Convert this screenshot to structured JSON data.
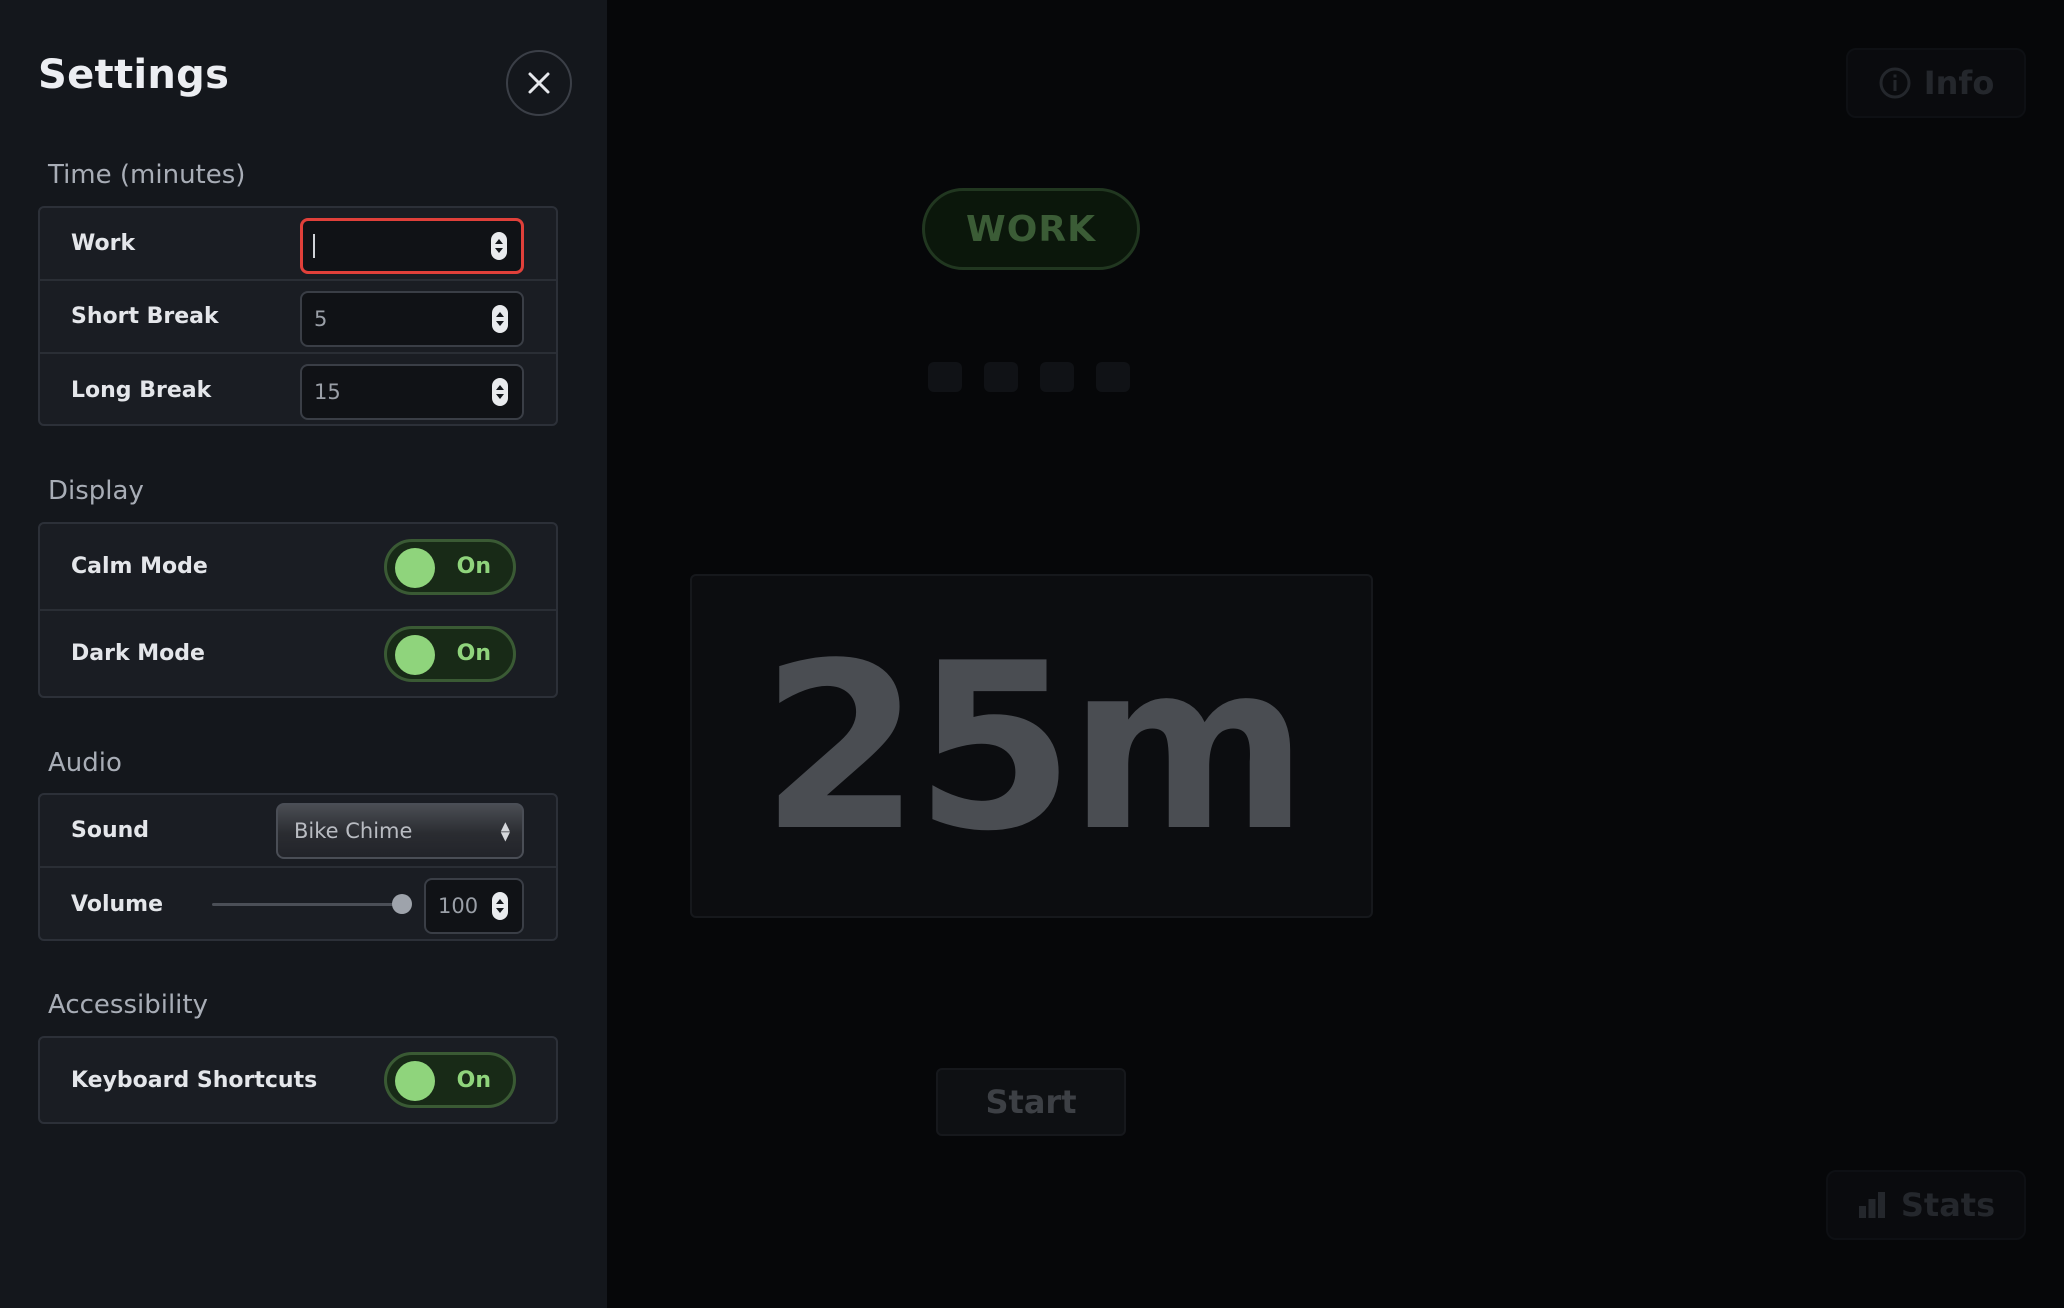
{
  "settings": {
    "title": "Settings",
    "sections": {
      "time": {
        "label": "Time (minutes)",
        "work": {
          "label": "Work",
          "value": ""
        },
        "short_break": {
          "label": "Short Break",
          "value": "5"
        },
        "long_break": {
          "label": "Long Break",
          "value": "15"
        }
      },
      "display": {
        "label": "Display",
        "calm_mode": {
          "label": "Calm Mode",
          "state": "On"
        },
        "dark_mode": {
          "label": "Dark Mode",
          "state": "On"
        }
      },
      "audio": {
        "label": "Audio",
        "sound": {
          "label": "Sound",
          "value": "Bike Chime"
        },
        "volume": {
          "label": "Volume",
          "value": "100"
        }
      },
      "accessibility": {
        "label": "Accessibility",
        "keyboard_shortcuts": {
          "label": "Keyboard Shortcuts",
          "state": "On"
        }
      }
    }
  },
  "main": {
    "info_label": "Info",
    "mode": "WORK",
    "timer": "25m",
    "start_label": "Start",
    "stats_label": "Stats"
  },
  "colors": {
    "toggle_on": "#8fd47c",
    "focus_border": "#e0403a",
    "panel_bg": "#14171c",
    "page_bg": "#060709"
  }
}
